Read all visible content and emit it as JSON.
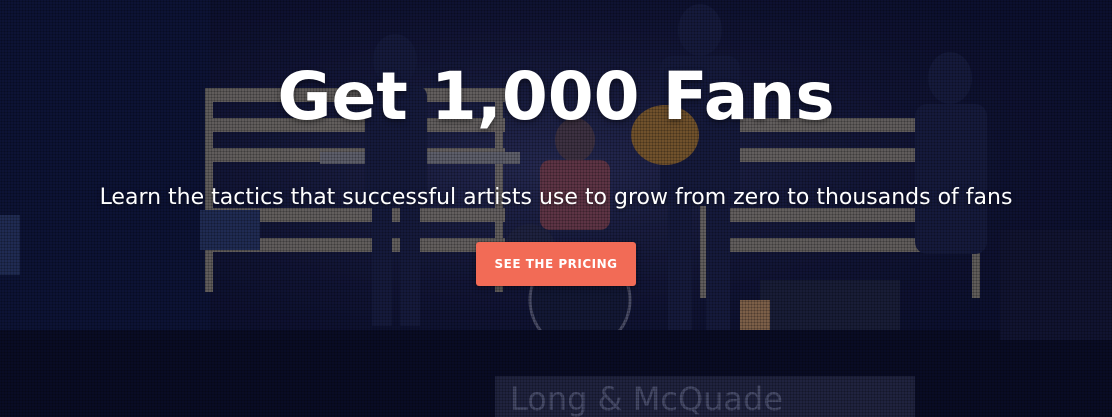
{
  "hero": {
    "headline": "Get 1,000 Fans",
    "subheadline": "Learn the tactics that successful artists use to grow from zero to thousands of fans",
    "cta_label": "SEE THE PRICING",
    "background_image_text": "Long & McQuade"
  },
  "colors": {
    "cta_background": "#f26b56",
    "text": "#ffffff",
    "overlay": "#0c0f2a"
  }
}
